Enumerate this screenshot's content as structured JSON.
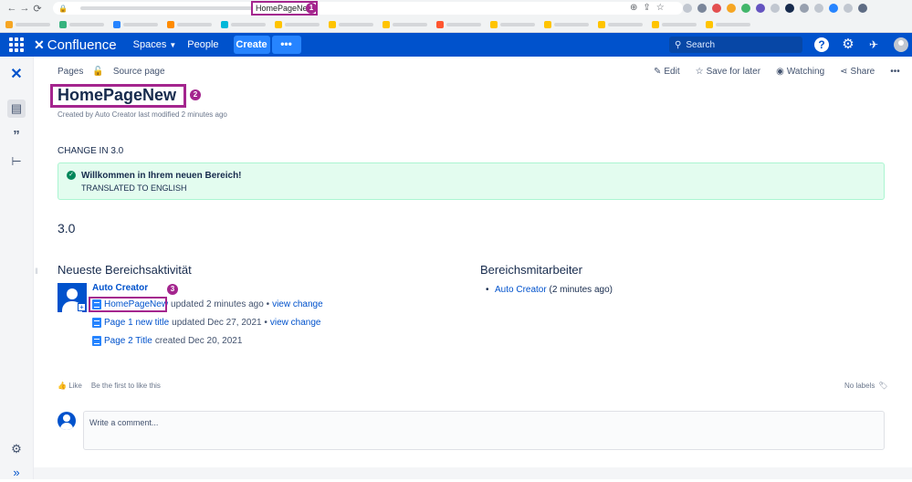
{
  "browser": {
    "tab_title": "HomePageNew",
    "badges": [
      "1",
      "2",
      "3"
    ]
  },
  "header": {
    "logo": "Confluence",
    "spaces": "Spaces",
    "people": "People",
    "create": "Create",
    "more": "•••",
    "search_placeholder": "Search",
    "colors": {
      "primary": "#0052cc",
      "highlight": "#a4258e"
    }
  },
  "breadcrumb": {
    "pages": "Pages",
    "source": "Source page"
  },
  "actions": {
    "edit": "Edit",
    "save": "Save for later",
    "watching": "Watching",
    "share": "Share",
    "more": "•••"
  },
  "page": {
    "title": "HomePageNew",
    "byline": "Created by Auto Creator last modified 2 minutes ago",
    "change": "CHANGE IN 3.0",
    "panel_title": "Willkommen in Ihrem neuen Bereich!",
    "panel_text": "TRANSLATED TO ENGLISH",
    "version": "3.0"
  },
  "activity": {
    "heading": "Neueste Bereichsaktivität",
    "user": "Auto Creator",
    "items": [
      {
        "title": "HomePageNew",
        "text": "updated 2 minutes ago •",
        "link": "view change"
      },
      {
        "title": "Page 1 new title",
        "text": "updated Dec 27, 2021 •",
        "link": "view change"
      },
      {
        "title": "Page 2 Title",
        "text": "created Dec 20, 2021",
        "link": ""
      }
    ]
  },
  "contributors": {
    "heading": "Bereichsmitarbeiter",
    "name": "Auto Creator",
    "when": "(2 minutes ago)"
  },
  "footer": {
    "like": "Like",
    "first_like": "Be the first to like this",
    "labels": "No labels",
    "comment_placeholder": "Write a comment..."
  }
}
